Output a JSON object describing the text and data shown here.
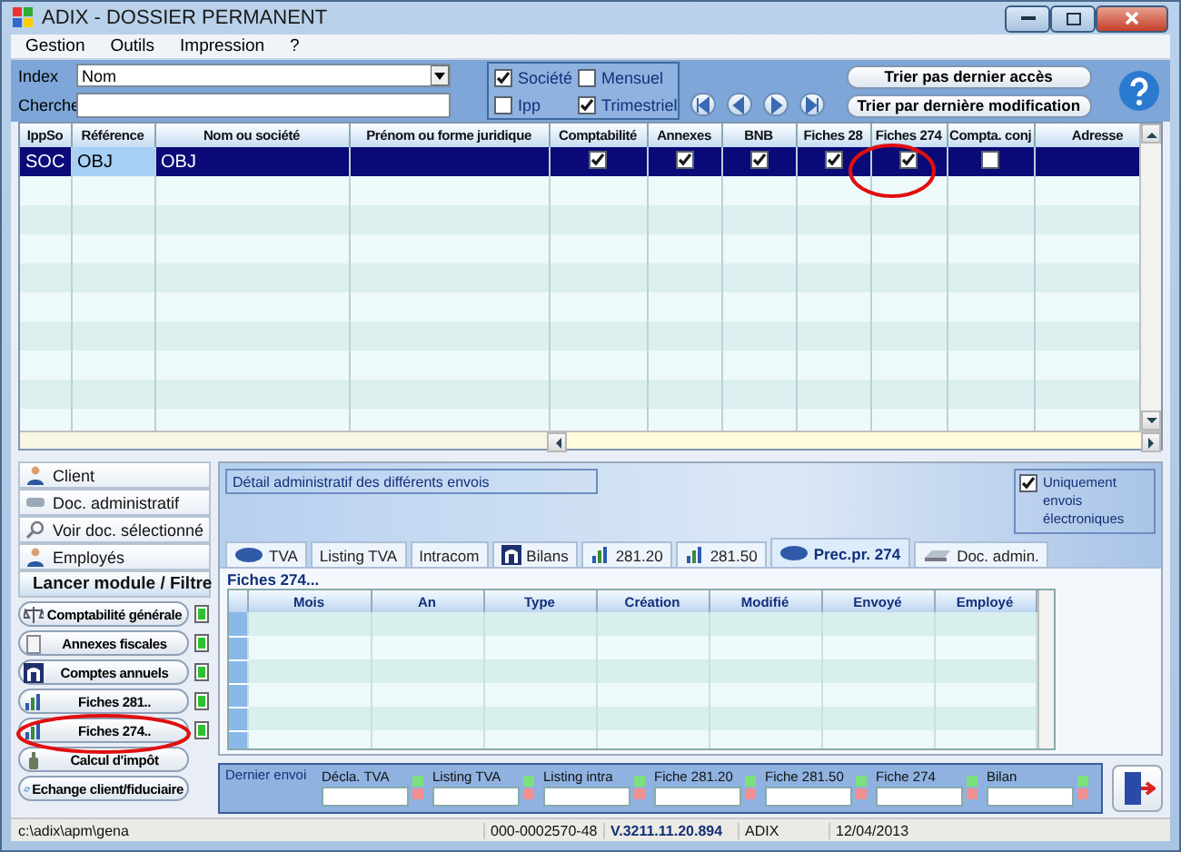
{
  "window": {
    "title": "ADIX - DOSSIER PERMANENT"
  },
  "menu": [
    "Gestion",
    "Outils",
    "Impression",
    "?"
  ],
  "filter": {
    "index_label": "Index",
    "index_value": "Nom",
    "search_label": "Cherche",
    "options": [
      {
        "label": "Société",
        "checked": true
      },
      {
        "label": "Ipp",
        "checked": false
      },
      {
        "label": "Mensuel",
        "checked": false
      },
      {
        "label": "Trimestriel",
        "checked": true
      }
    ]
  },
  "sort_buttons": [
    "Trier pas dernier accès",
    "Trier par dernière modification"
  ],
  "table": {
    "columns": [
      {
        "label": "IppSo",
        "kind": "text"
      },
      {
        "label": "Référence",
        "kind": "text"
      },
      {
        "label": "Nom ou société",
        "kind": "text"
      },
      {
        "label": "Prénom ou forme juridique",
        "kind": "text"
      },
      {
        "label": "Comptabilité",
        "kind": "check"
      },
      {
        "label": "Annexes",
        "kind": "check"
      },
      {
        "label": "BNB",
        "kind": "check"
      },
      {
        "label": "Fiches 28",
        "kind": "check"
      },
      {
        "label": "Fiches 274",
        "kind": "check"
      },
      {
        "label": "Compta. conj",
        "kind": "check"
      },
      {
        "label": "Adresse",
        "kind": "text"
      }
    ],
    "rows": [
      {
        "selected": true,
        "cells": [
          {
            "text": "SOC"
          },
          {
            "text": "OBJ"
          },
          {
            "text": "OBJ"
          },
          null,
          {
            "checked": true
          },
          {
            "checked": true
          },
          {
            "checked": true
          },
          {
            "checked": true
          },
          {
            "checked": true
          },
          {
            "checked": false
          },
          null
        ]
      }
    ]
  },
  "nav": [
    {
      "label": "Client",
      "selected": false
    },
    {
      "label": "Doc. administratif",
      "selected": false
    },
    {
      "label": "Voir doc. sélectionné",
      "selected": false
    },
    {
      "label": "Employés",
      "selected": false
    },
    {
      "label": "Lancer module / Filtre",
      "selected": true
    }
  ],
  "modules": [
    {
      "label": "Comptabilité générale",
      "indicator": true
    },
    {
      "label": "Annexes fiscales",
      "indicator": true
    },
    {
      "label": "Comptes annuels",
      "indicator": true
    },
    {
      "label": "Fiches 281..",
      "indicator": true
    },
    {
      "label": "Fiches 274..",
      "indicator": true
    },
    {
      "label": "Calcul d'impôt",
      "indicator": false
    },
    {
      "label": "Echange client/fiduciaire",
      "indicator": false
    }
  ],
  "detail": {
    "caption": "Détail administratif des différents envois",
    "electronic_only": {
      "label": "Uniquement envois électroniques",
      "checked": true
    }
  },
  "tabs": [
    {
      "label": "TVA",
      "selected": false
    },
    {
      "label": "Listing TVA",
      "selected": false
    },
    {
      "label": "Intracom",
      "selected": false
    },
    {
      "label": "Bilans",
      "selected": false
    },
    {
      "label": "281.20",
      "selected": false
    },
    {
      "label": "281.50",
      "selected": false
    },
    {
      "label": "Prec.pr. 274",
      "selected": true
    },
    {
      "label": "Doc. admin.",
      "selected": false
    }
  ],
  "sub_table": {
    "title": "Fiches 274...",
    "columns": [
      "Mois",
      "An",
      "Type",
      "Création",
      "Modifié",
      "Envoyé",
      "Employé"
    ]
  },
  "last_sent": {
    "label": "Dernier envoi",
    "fields": [
      "Décla. TVA",
      "Listing TVA",
      "Listing intra",
      "Fiche 281.20",
      "Fiche 281.50",
      "Fiche 274",
      "Bilan"
    ]
  },
  "status_bar": [
    "c:\\adix\\apm\\gena",
    "000-0002570-48",
    "V.3211.11.20.894",
    "ADIX",
    "12/04/2013"
  ]
}
